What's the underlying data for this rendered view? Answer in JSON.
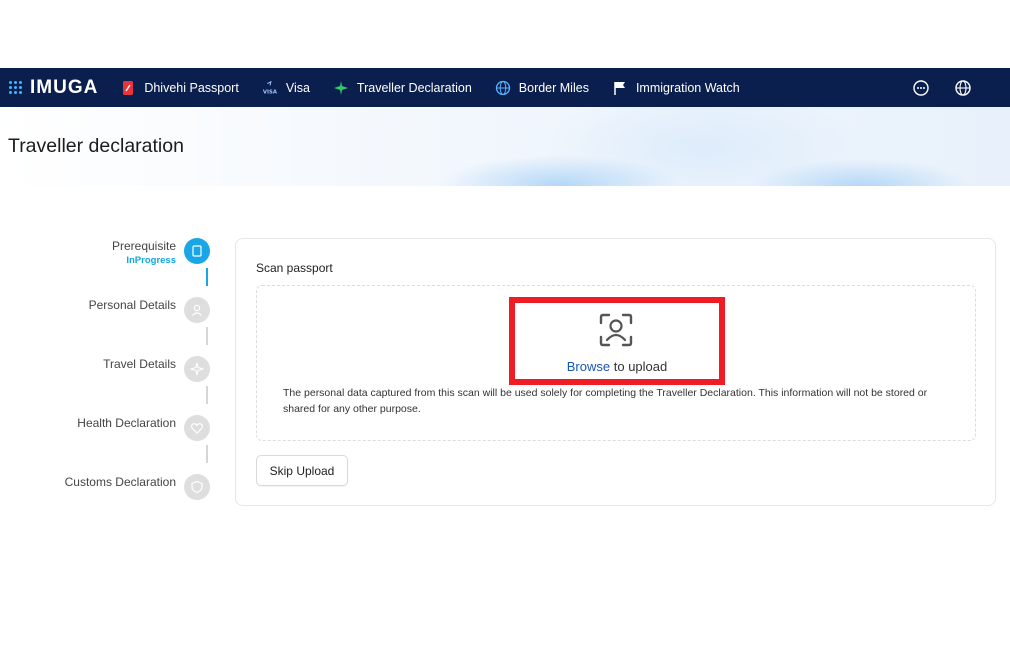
{
  "brand": {
    "name": "IMUGA",
    "accent": "#3fb6ff",
    "nav_bg": "#0b1f4e"
  },
  "nav": {
    "items": [
      {
        "label": "Dhivehi Passport",
        "icon": "passport-icon"
      },
      {
        "label": "Visa",
        "icon": "visa-icon"
      },
      {
        "label": "Traveller Declaration",
        "icon": "airplane-icon"
      },
      {
        "label": "Border Miles",
        "icon": "globe-network-icon"
      },
      {
        "label": "Immigration Watch",
        "icon": "flag-icon"
      }
    ],
    "right_icons": [
      "chat-icon",
      "language-globe-icon"
    ]
  },
  "page": {
    "title": "Traveller declaration"
  },
  "stepper": {
    "steps": [
      {
        "label": "Prerequisite",
        "status": "InProgress",
        "icon": "passport-icon",
        "active": true
      },
      {
        "label": "Personal Details",
        "status": "",
        "icon": "user-icon",
        "active": false
      },
      {
        "label": "Travel Details",
        "status": "",
        "icon": "airplane-icon",
        "active": false
      },
      {
        "label": "Health Declaration",
        "status": "",
        "icon": "heart-icon",
        "active": false
      },
      {
        "label": "Customs Declaration",
        "status": "",
        "icon": "shield-icon",
        "active": false
      }
    ]
  },
  "scan": {
    "title": "Scan passport",
    "icon": "face-scan-icon",
    "browse_label": "Browse",
    "upload_suffix": " to upload",
    "privacy_text": "The personal data captured from this scan will be used solely for completing the Traveller Declaration. This information will not be stored or shared for any other purpose.",
    "skip_label": "Skip Upload",
    "highlight_color": "#ee1c25"
  }
}
